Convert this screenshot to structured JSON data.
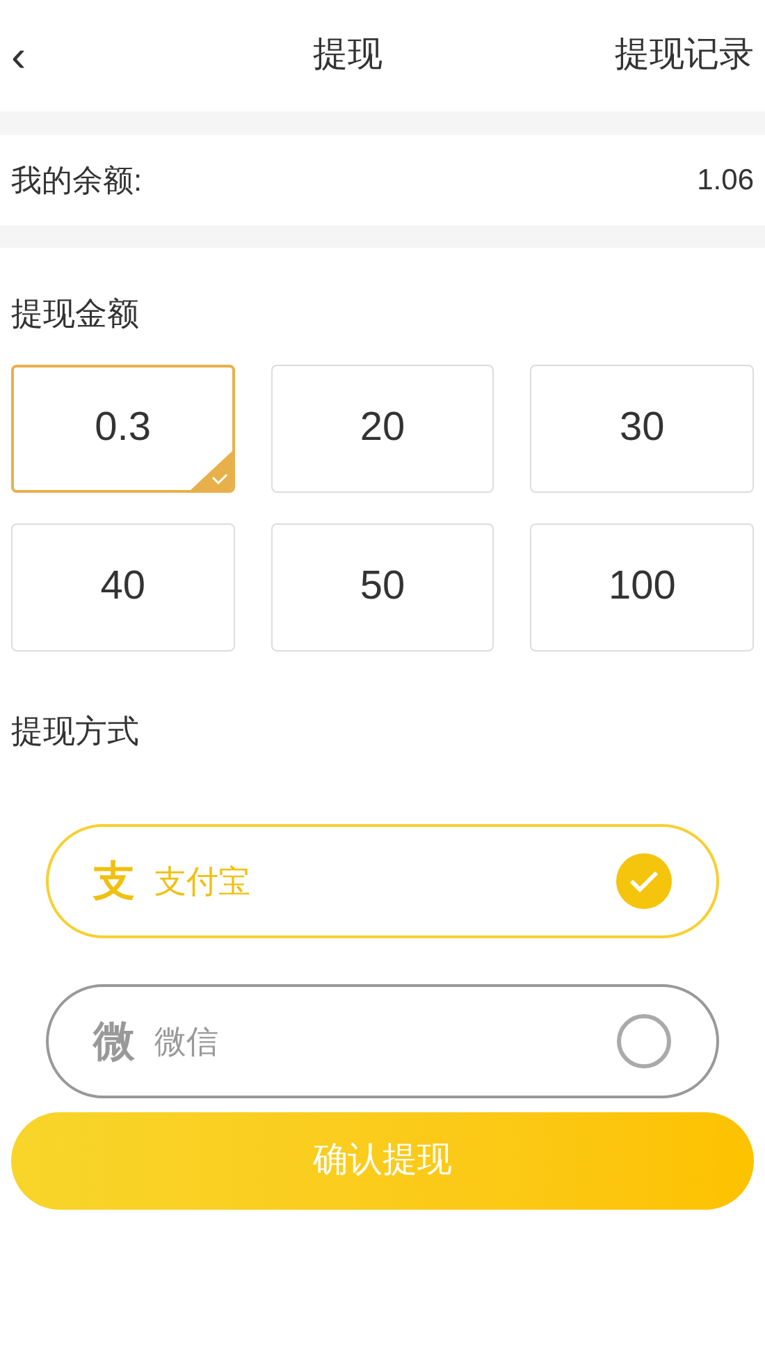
{
  "header": {
    "back": "‹",
    "title": "提现",
    "action": "提现记录"
  },
  "balance": {
    "label": "我的余额:",
    "value": "1.06"
  },
  "amount_section": {
    "title": "提现金额",
    "options": [
      {
        "label": "0.3",
        "selected": true
      },
      {
        "label": "20",
        "selected": false
      },
      {
        "label": "30",
        "selected": false
      },
      {
        "label": "40",
        "selected": false
      },
      {
        "label": "50",
        "selected": false
      },
      {
        "label": "100",
        "selected": false
      }
    ]
  },
  "method_section": {
    "title": "提现方式",
    "options": [
      {
        "icon_char": "支",
        "label": "支付宝",
        "selected": true
      },
      {
        "icon_char": "微",
        "label": "微信",
        "selected": false
      }
    ]
  },
  "submit": "确认提现"
}
